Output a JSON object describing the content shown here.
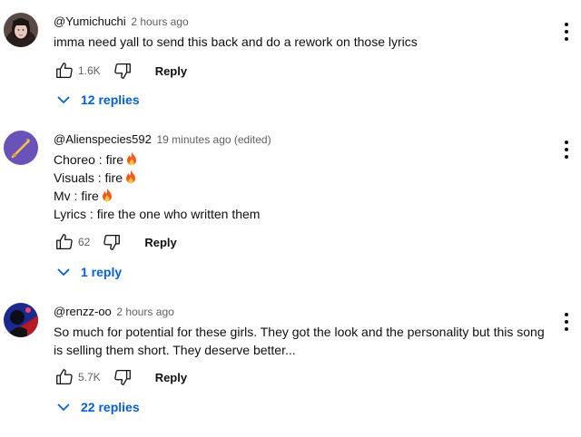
{
  "comments": [
    {
      "author": "@Yumichuchi",
      "time": "2 hours ago",
      "text_lines": [
        "imma need yall to send this back and do a rework on those lyrics"
      ],
      "likes": "1.6K",
      "reply_label": "Reply",
      "replies_label": "12 replies"
    },
    {
      "author": "@Alienspecies592",
      "time": "19 minutes ago (edited)",
      "text_lines": [
        "Choreo : fire",
        "Visuals : fire",
        "Mv : fire",
        "Lyrics : fire the one who written them"
      ],
      "likes": "62",
      "reply_label": "Reply",
      "replies_label": "1 reply"
    },
    {
      "author": "@renzz-oo",
      "time": "2 hours ago",
      "text_lines": [
        "So much for potential for these girls. They got the look and the personality but this song",
        "is selling them short. They deserve better..."
      ],
      "likes": "5.7K",
      "reply_label": "Reply",
      "replies_label": "22 replies"
    }
  ],
  "colors": {
    "text": "#0f0f0f",
    "secondary": "#606060",
    "link_blue": "#065fd4",
    "fire": "#f25a1d"
  },
  "icons": {
    "like": "thumbs-up-icon",
    "dislike": "thumbs-down-icon",
    "menu": "more-vert-icon",
    "expand": "chevron-down-icon",
    "emoji": "fire-emoji"
  }
}
